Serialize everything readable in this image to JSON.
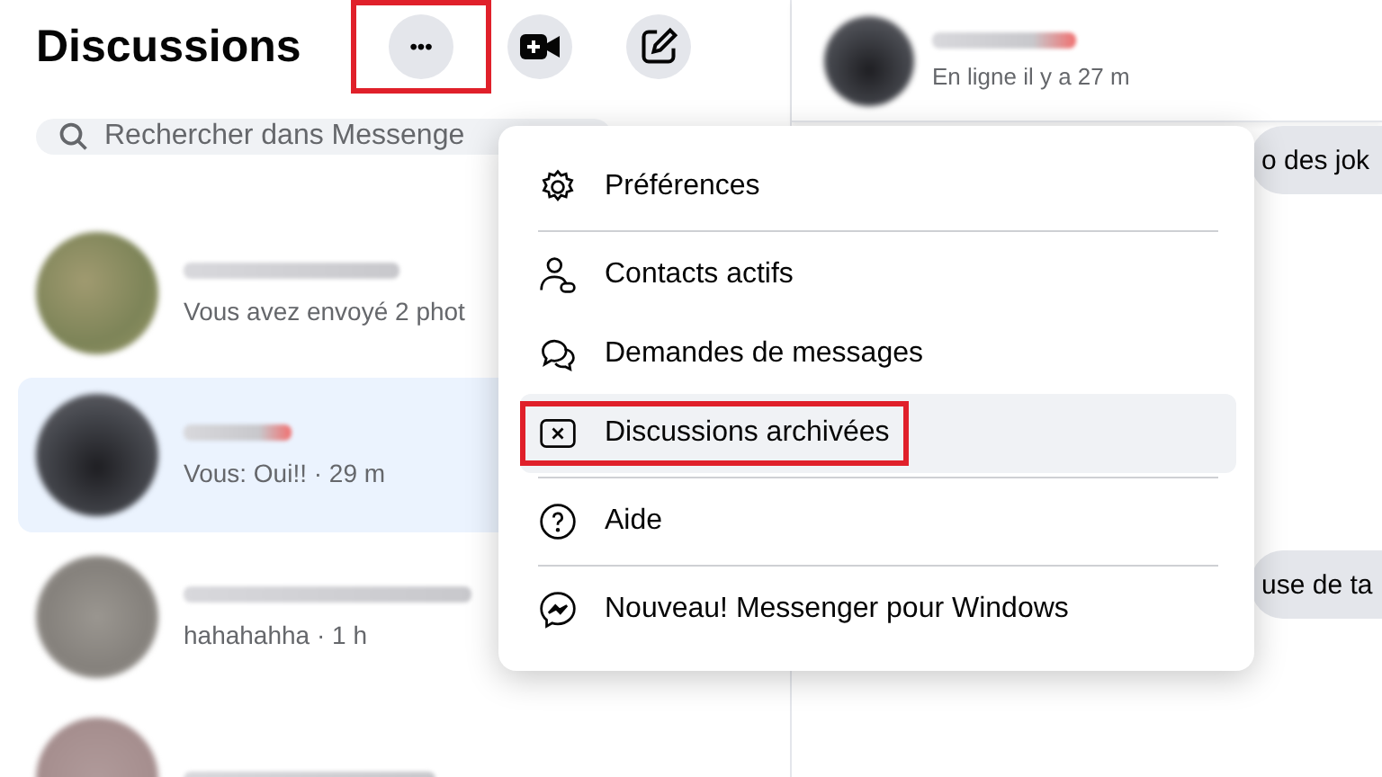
{
  "sidebar": {
    "title": "Discussions",
    "header_buttons": [
      {
        "kind": "more",
        "label": "•••",
        "highlighted": true
      },
      {
        "kind": "video",
        "highlighted": false
      },
      {
        "kind": "compose",
        "highlighted": false
      }
    ],
    "search": {
      "placeholder": "Rechercher dans Messenge"
    },
    "conversations": [
      {
        "preview": "Vous avez envoyé 2 phot",
        "selected": false
      },
      {
        "preview": "Vous: Oui!! · 29 m",
        "selected": true
      },
      {
        "preview": "hahahahha · 1 h",
        "selected": false
      },
      {
        "selected": false
      }
    ]
  },
  "chat": {
    "status": "En ligne il y a 27 m",
    "messages": [
      "o des jok",
      "use de ta"
    ]
  },
  "menu": {
    "groups": [
      [
        {
          "kind": "settings",
          "label": "Préférences",
          "hovered": false,
          "highlighted": false
        }
      ],
      [
        {
          "kind": "contacts",
          "label": "Contacts actifs",
          "hovered": false,
          "highlighted": false
        },
        {
          "kind": "requests",
          "label": "Demandes de messages",
          "hovered": false,
          "highlighted": false
        },
        {
          "kind": "archive",
          "label": "Discussions archivées",
          "hovered": true,
          "highlighted": true
        }
      ],
      [
        {
          "kind": "help",
          "label": "Aide",
          "hovered": false,
          "highlighted": false
        }
      ],
      [
        {
          "kind": "messenger",
          "label": "Nouveau! Messenger pour Windows",
          "hovered": false,
          "highlighted": false
        }
      ]
    ]
  }
}
